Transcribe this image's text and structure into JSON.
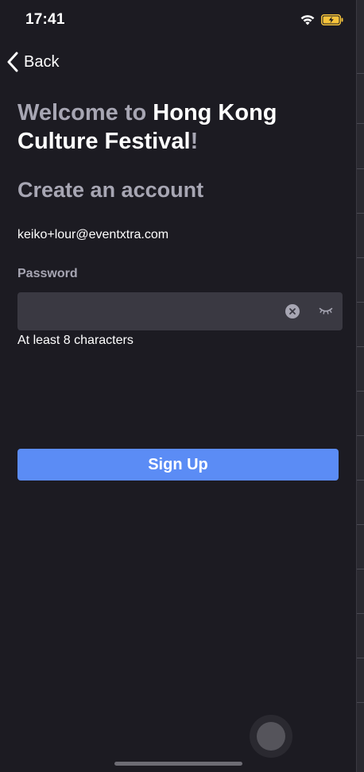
{
  "status_bar": {
    "time": "17:41",
    "wifi_icon": "wifi-icon",
    "battery_icon": "battery-charging-icon"
  },
  "nav": {
    "back_label": "Back",
    "back_icon": "chevron-left-icon"
  },
  "welcome": {
    "prefix": "Welcome to ",
    "event_name": "Hong Kong Culture Festival",
    "suffix": "!"
  },
  "form": {
    "subtitle": "Create an account",
    "email": "keiko+lour@eventxtra.com",
    "password_label": "Password",
    "password_value": "",
    "clear_icon": "clear-icon",
    "eye_icon": "eye-closed-icon",
    "password_hint": "At least 8 characters",
    "submit_label": "Sign Up"
  },
  "colors": {
    "background": "#1c1b22",
    "muted_text": "#a7a6b3",
    "field_background": "#3a3942",
    "accent": "#5b8cf5"
  }
}
